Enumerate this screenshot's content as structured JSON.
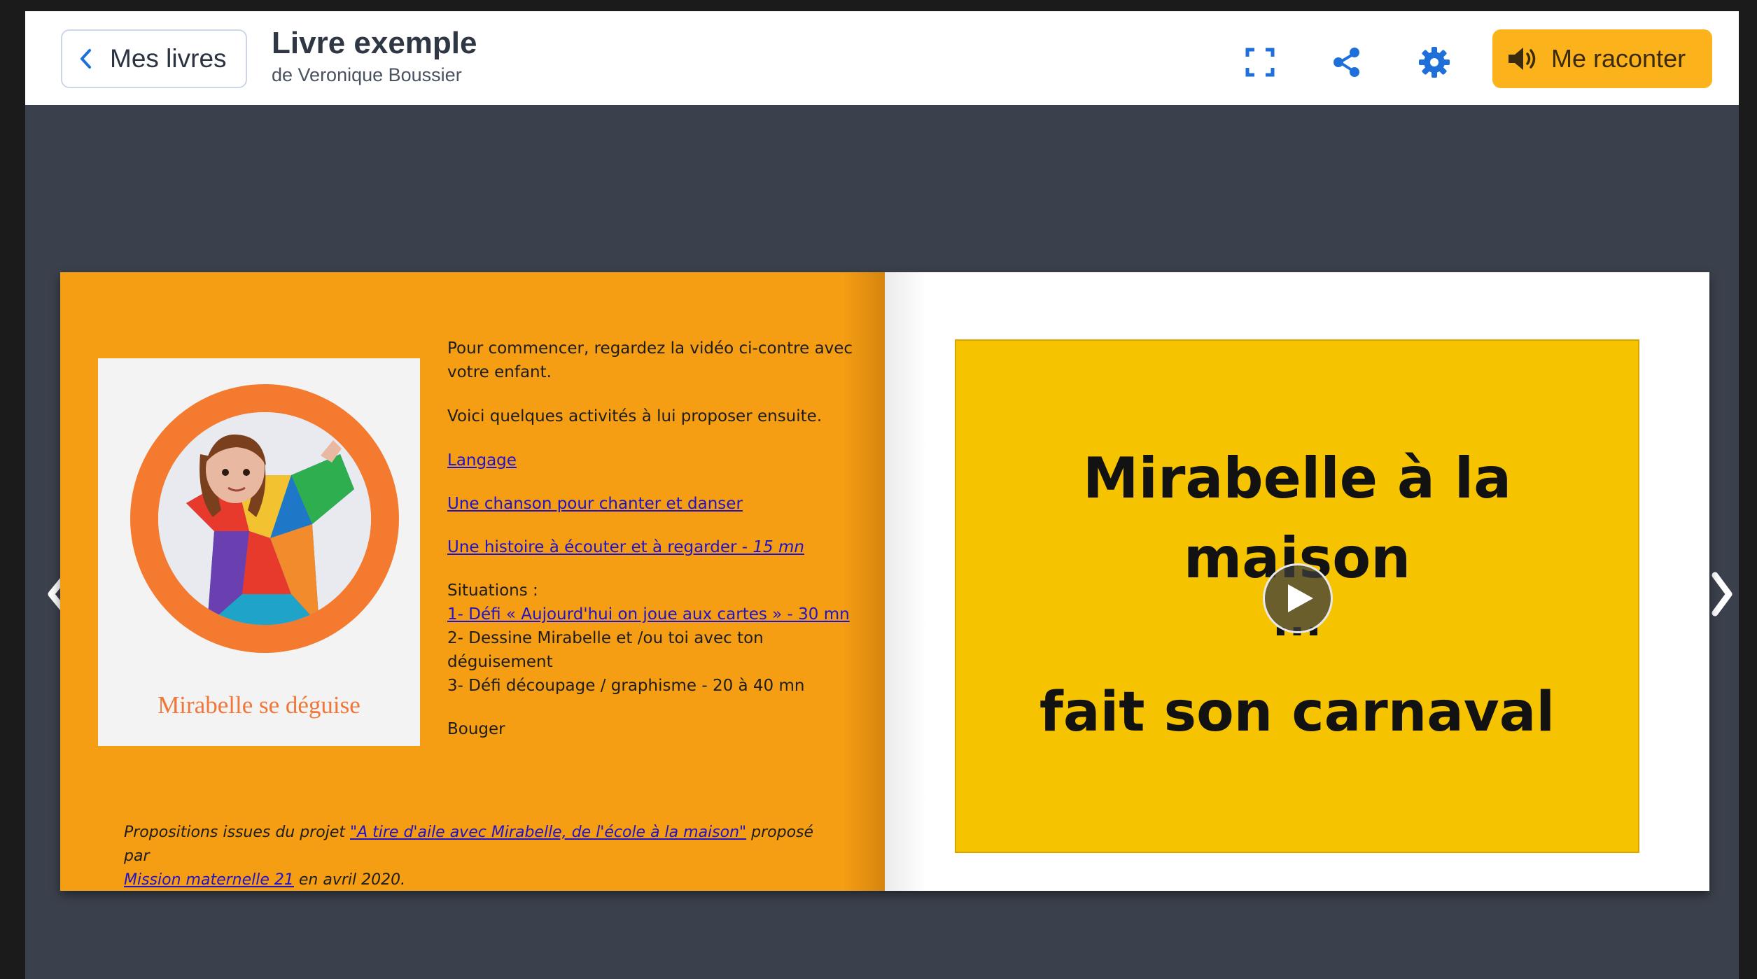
{
  "header": {
    "back_label": "Mes livres",
    "title": "Livre exemple",
    "author": "de Veronique Boussier",
    "narrate_label": "Me raconter",
    "accent_color": "#fbb21b",
    "icons": [
      "fullscreen-icon",
      "share-icon",
      "settings-icon",
      "speaker-icon"
    ]
  },
  "left_page": {
    "cover_title": "Mirabelle se déguise",
    "intro": "Pour commencer, regardez la vidéo ci-contre avec votre enfant.",
    "activities_intro": "Voici quelques activités à lui proposer ensuite.",
    "link_langage": "Langage",
    "link_chanson": "Une chanson pour chanter et danser",
    "link_histoire": "Une histoire à écouter et à regarder - ",
    "link_histoire_duration": "15 mn",
    "situations_label": "Situations :",
    "situation_1": "1- Défi « Aujourd'hui on joue aux cartes » - 30 mn",
    "situation_2": "2- Dessine Mirabelle et /ou toi avec ton déguisement",
    "situation_3": "3- Défi découpage / graphisme - 20 à 40 mn",
    "bouger": "Bouger",
    "footer_prefix": "Propositions issues du projet ",
    "footer_project_link": "\"A tire d'aile avec Mirabelle, de l'école à la maison\"",
    "footer_middle": " proposé par",
    "footer_org_link": "Mission maternelle 21",
    "footer_suffix": " en avril 2020.",
    "background_color": "#f59d13"
  },
  "right_page": {
    "video_line_1": "Mirabelle à la",
    "video_line_2": "maison",
    "video_line_3": "...",
    "video_line_4": "fait son carnaval",
    "video_background": "#f5c300"
  },
  "navigation": {
    "prev_icon": "chevron-left-icon",
    "next_icon": "chevron-right-icon"
  }
}
